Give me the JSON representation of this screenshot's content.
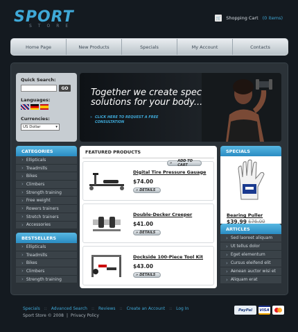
{
  "brand": {
    "name": "SPORT",
    "tagline": "STORE"
  },
  "cart": {
    "label": "Shopping Cart",
    "count": "(0 items)",
    "icon": "cart-icon"
  },
  "nav": [
    "Home Page",
    "New Products",
    "Specials",
    "My Account",
    "Contacts"
  ],
  "search": {
    "label": "Quick Search:",
    "button": "GO",
    "placeholder": ""
  },
  "languages": {
    "label": "Languages:",
    "flags": [
      "uk-flag",
      "germany-flag",
      "spain-flag"
    ]
  },
  "currencies": {
    "label": "Currencies:",
    "selected": "US Dollar"
  },
  "banner": {
    "title_line1": "Together we create special",
    "title_line2": "solutions for your body...",
    "link_line1": "CLICK HERE TO REQUEST  A FREE",
    "link_line2": "CONSULTATION"
  },
  "categories": {
    "title": "CATEGORIES",
    "items": [
      "Ellipticals",
      "Treadmills",
      "Bikes",
      "Climbers",
      "Strength training",
      "Free weight",
      "Rowers trainers",
      "Stretch trainers",
      "Accessories"
    ]
  },
  "bestsellers": {
    "title": "BESTSELLERS",
    "items": [
      "Ellipticals",
      "Treadmills",
      "Bikes",
      "Climbers",
      "Strength training"
    ]
  },
  "featured": {
    "title": "FEATURED PRODUCTS",
    "details_label": "DETAILS",
    "cart_label": "ADD TO CART",
    "products": [
      {
        "name": "Digital Tire Pressure Gauage",
        "price": "$74.00"
      },
      {
        "name": "Double-Decker Creeper",
        "price": "$41.00"
      },
      {
        "name": "Dockside 100-Piece Tool Kit",
        "price": "$43.00"
      }
    ]
  },
  "specials": {
    "title": "SPECIALS",
    "name": "Bearing Puller",
    "price": "$39.99",
    "old_price": "$76.00"
  },
  "articles": {
    "title": "ARTICLES",
    "items": [
      "Sed laoreet aliquam",
      "Ut tellus dolor",
      "Eget elementum",
      "Cursus eleifend elit",
      "Aenean auctor wisi et",
      "Aliquam erat"
    ]
  },
  "footer": {
    "links": [
      "Specials",
      "Advanced Search",
      "Reviews",
      "Create an Account",
      "Log In"
    ],
    "copyright": "Sport Store  © 2008",
    "policy": "Privacy Policy"
  },
  "payments": [
    "PayPal",
    "VISA",
    "mastercard-icon"
  ],
  "colors": {
    "accent": "#3fa9d8",
    "background": "#141a20",
    "panel": "#2b3238"
  }
}
